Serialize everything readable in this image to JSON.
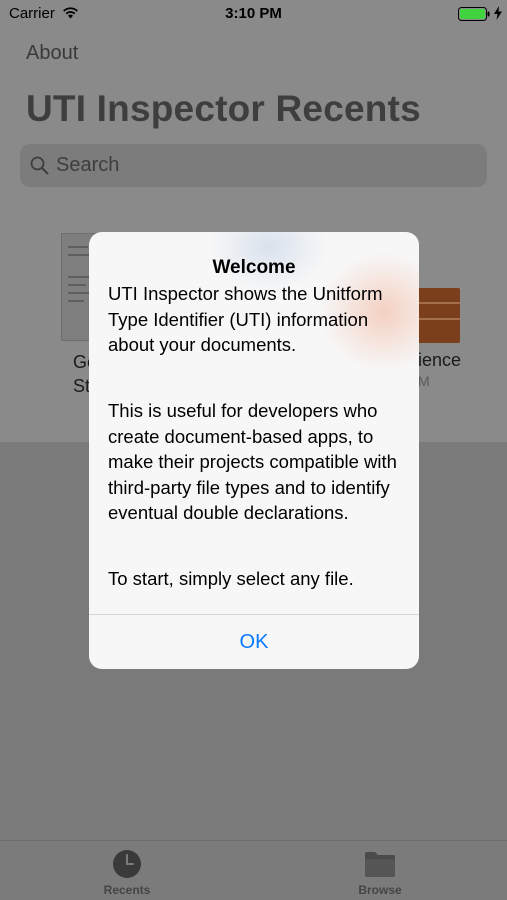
{
  "status_bar": {
    "carrier": "Carrier",
    "time": "3:10 PM",
    "wifi_icon": "wifi-icon",
    "battery_icon": "battery-icon",
    "charging_icon": "charging-bolt-icon"
  },
  "nav": {
    "about_label": "About",
    "title": "UTI Inspector Recents"
  },
  "search": {
    "placeholder": "Search",
    "icon": "search-icon"
  },
  "recents": [
    {
      "label_line1": "Ge",
      "label_line2": "St",
      "thumb": "document-thumbnail"
    },
    {
      "label": "ience",
      "time": "M",
      "thumb": "book-cover-thumbnail"
    }
  ],
  "alert": {
    "title": "Welcome",
    "paragraph1": "UTI Inspector shows the Unitform Type Identifier (UTI) information about your documents.",
    "paragraph2": "This is useful for developers who create document-based apps, to make their projects compatible with third-party file types and to identify eventual double declarations.",
    "paragraph3": "To start, simply select any file.",
    "ok_label": "OK",
    "ok_color": "#0a7aff"
  },
  "tabbar": {
    "tabs": [
      {
        "label": "Recents",
        "icon": "clock-icon"
      },
      {
        "label": "Browse",
        "icon": "folder-icon"
      }
    ]
  },
  "colors": {
    "dim_background": "#7a7a7a",
    "alert_background": "#f7f7f7",
    "accent": "#0a7aff"
  }
}
